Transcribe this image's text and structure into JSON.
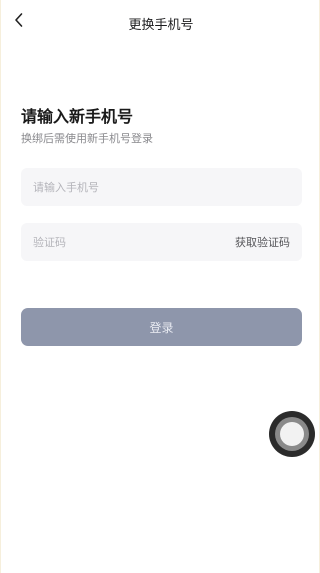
{
  "nav": {
    "title": "更换手机号",
    "back_icon": "chevron-left-icon"
  },
  "form": {
    "heading": "请输入新手机号",
    "subheading": "换绑后需使用新手机号登录",
    "phone_placeholder": "请输入手机号",
    "code_placeholder": "验证码",
    "get_code_label": "获取验证码",
    "submit_label": "登录"
  },
  "colors": {
    "submit_button": "#8e96ab",
    "field_background": "#f6f6f8",
    "text_primary": "#1a1a1a",
    "text_secondary": "#8a8a8e"
  },
  "assistive_touch": {
    "icon": "assistive-touch-icon"
  }
}
